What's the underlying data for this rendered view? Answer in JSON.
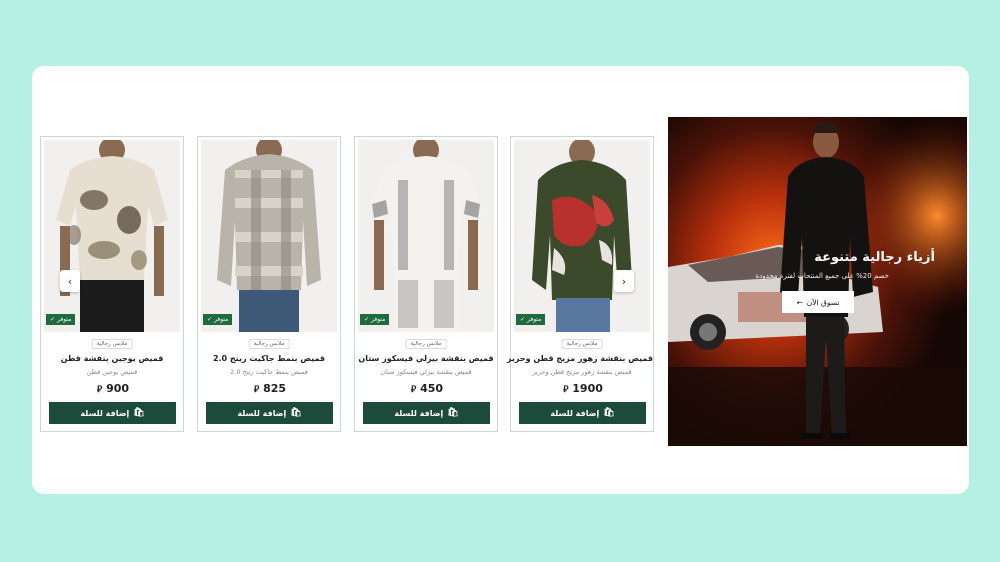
{
  "colors": {
    "background": "#b6efe4",
    "accent": "#1d4b3b",
    "stock_badge": "#1f6b3f"
  },
  "banner": {
    "title": "أزياء رجالية متنوعة",
    "subtitle": "خصم 20% على جميع المنتجات لفترة محدودة",
    "cta_label": "تسوق الآن",
    "cta_icon": "arrow-left-icon"
  },
  "products": [
    {
      "category": "ملابس رجالية",
      "name": "قميص بنقشة زهور مزيج قطن وحرير",
      "description": "قميص بنقشة زهور مزيج قطن وحرير",
      "price": "1900",
      "currency": "ر.س",
      "stock": "متوفر",
      "add_label": "إضافة للسلة"
    },
    {
      "category": "ملابس رجالية",
      "name": "قميص بنقشة بيزلي فيسكوز ستان",
      "description": "قميص بنقشة بيزلي فيسكوز ستان",
      "price": "450",
      "currency": "ر.س",
      "stock": "متوفر",
      "add_label": "إضافة للسلة"
    },
    {
      "category": "ملابس رجالية",
      "name": "قميص بنمط جاكيت رينج 2.0",
      "description": "قميص بنمط جاكيت رينج 2.0",
      "price": "825",
      "currency": "ر.س",
      "stock": "متوفر",
      "add_label": "إضافة للسلة"
    },
    {
      "category": "ملابس رجالية",
      "name": "قميص يوجين بنقشة قطن",
      "description": "قميص يوجين قطن",
      "price": "900",
      "currency": "ر.س",
      "stock": "متوفر",
      "add_label": "إضافة للسلة"
    }
  ],
  "carousel": {
    "prev_icon": "chevron-left-icon",
    "next_icon": "chevron-right-icon"
  }
}
